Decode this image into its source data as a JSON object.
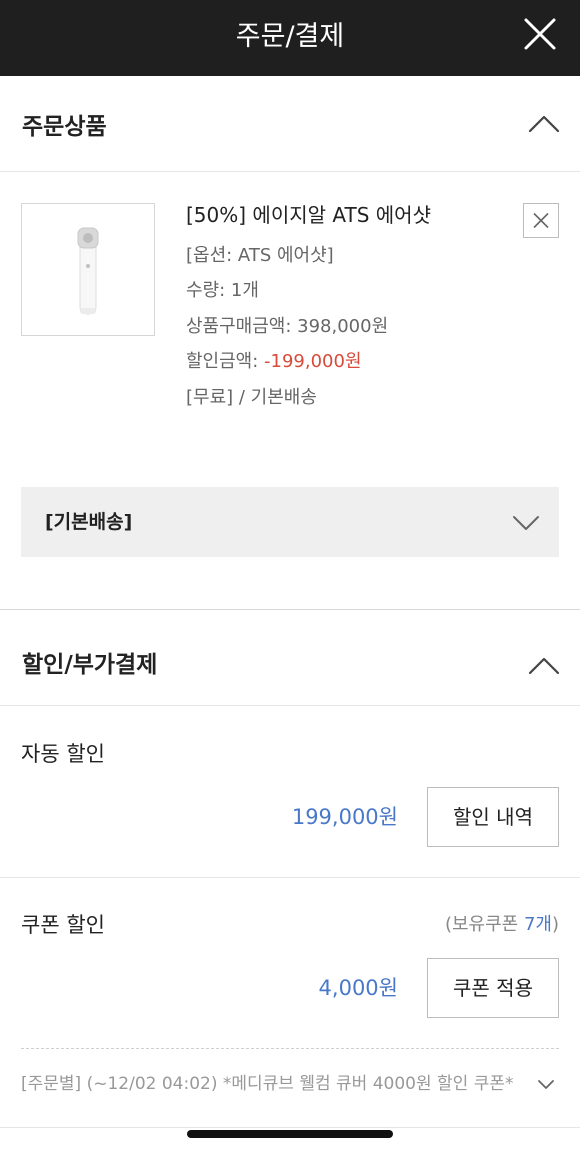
{
  "header": {
    "title": "주문/결제",
    "close_icon": "close-icon"
  },
  "order_section": {
    "title": "주문상품",
    "product": {
      "name": "[50%] 에이지알 ATS 에어샷",
      "option": "[옵션: ATS 에어샷]",
      "quantity": "수량: 1개",
      "price_label": "상품구매금액: ",
      "price": "398,000원",
      "discount_label": "할인금액: ",
      "discount": "-199,000원",
      "shipping": "[무료] / 기본배송"
    },
    "shipping_group": "[기본배송]"
  },
  "discount_section": {
    "title": "할인/부가결제",
    "auto": {
      "label": "자동 할인",
      "amount": "199,000원",
      "button": "할인 내역"
    },
    "coupon": {
      "label": "쿠폰 할인",
      "owned_prefix": "(보유쿠폰 ",
      "owned_count": "7개",
      "owned_suffix": ")",
      "amount": "4,000원",
      "button": "쿠폰 적용",
      "detail": "[주문별] (~12/02 04:02) *메디큐브 웰컴 큐버 4000원 할인 쿠폰*"
    }
  },
  "colors": {
    "header_bg": "#1f1f1f",
    "accent_blue": "#4a78c9",
    "discount_red": "#d84b3a"
  }
}
